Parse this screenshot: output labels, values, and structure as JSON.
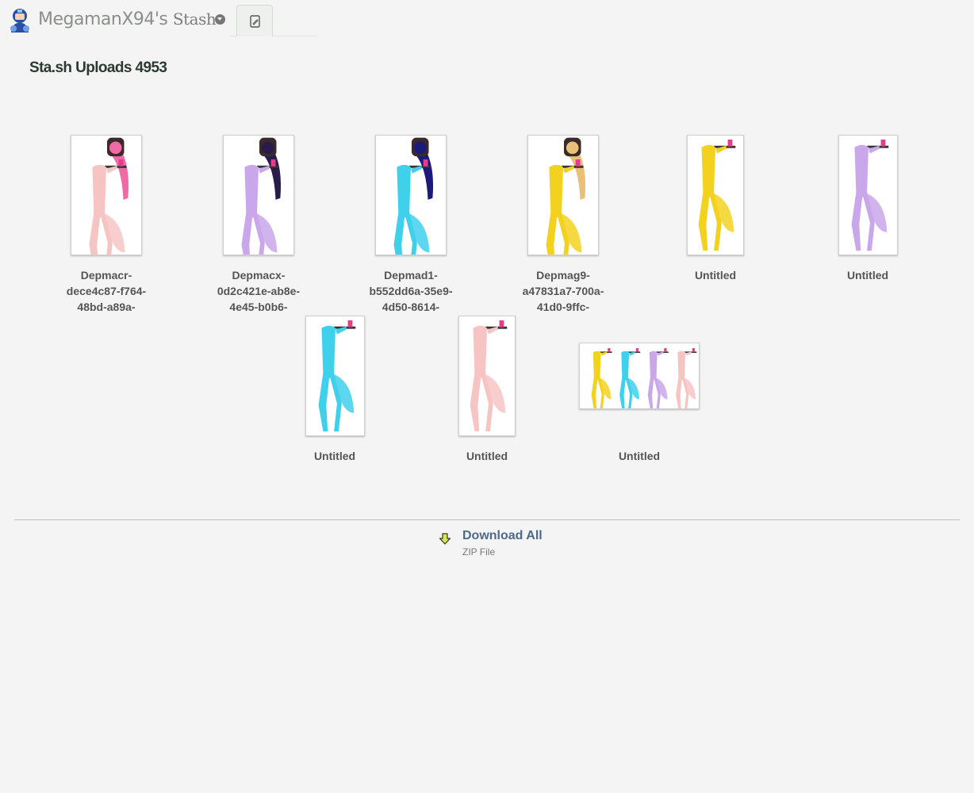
{
  "header": {
    "owner_name": "MegamanX94's",
    "stash_label": "Stash"
  },
  "page": {
    "title": "Sta.sh Uploads 4953"
  },
  "items": [
    {
      "caption": [
        "Depmacr-",
        "dece4c87-f764-",
        "48bd-a89a-"
      ],
      "hair": "#f06aa6",
      "body": "#f7c4c4"
    },
    {
      "caption": [
        "Depmacx-",
        "0d2c421e-ab8e-",
        "4e45-b0b6-"
      ],
      "hair": "#2a1c4a",
      "body": "#c9a7ea"
    },
    {
      "caption": [
        "Depmad1-",
        "b552dd6a-35e9-",
        "4d50-8614-"
      ],
      "hair": "#1c1a7a",
      "body": "#3fd0ec"
    },
    {
      "caption": [
        "Depmag9-",
        "a47831a7-700a-",
        "41d0-9ffc-"
      ],
      "hair": "#e9c07a",
      "body": "#f3d21f"
    },
    {
      "caption": [
        "Untitled"
      ],
      "body": "#f3d21f"
    },
    {
      "caption": [
        "Untitled"
      ],
      "body": "#c9a7ea"
    },
    {
      "caption": [
        "Untitled"
      ],
      "body": "#3fd0ec"
    },
    {
      "caption": [
        "Untitled"
      ],
      "body": "#f7c4c4"
    },
    {
      "caption": [
        "Untitled"
      ],
      "group": [
        "#f3d21f",
        "#3fd0ec",
        "#c9a7ea",
        "#f7c4c4"
      ]
    }
  ],
  "download": {
    "label": "Download All",
    "sublabel": "ZIP File"
  }
}
